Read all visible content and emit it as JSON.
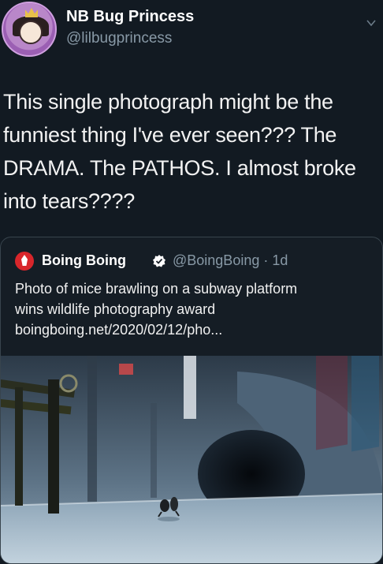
{
  "user": {
    "display_name": "NB Bug Princess",
    "handle": "@lilbugprincess",
    "avatar_icon": "avatar-icon"
  },
  "tweet": {
    "lines": [
      "This single photograph might be the",
      "funniest thing I've ever seen??? The",
      "DRAMA. The PATHOS. I almost broke",
      "into tears????"
    ]
  },
  "quote": {
    "name": "Boing Boing",
    "handle_time": "@BoingBoing · 1d",
    "text_lines": [
      "Photo of mice brawling on a subway platform",
      "wins wildlife photography award",
      "boingboing.net/2020/02/12/pho..."
    ]
  },
  "colors": {
    "background": "#121a22",
    "muted_text": "#8899a6",
    "border": "#38444d",
    "verified": "#ffffff",
    "brand_red": "#d8262b"
  }
}
